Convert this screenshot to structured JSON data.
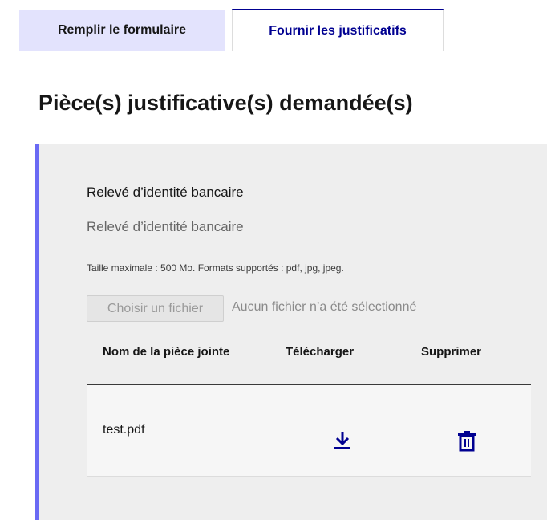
{
  "tabs": [
    {
      "label": "Remplir le formulaire",
      "active": false
    },
    {
      "label": "Fournir les justificatifs",
      "active": true
    }
  ],
  "page_title": "Pièce(s) justificative(s) demandée(s)",
  "document": {
    "label": "Relevé d’identité bancaire",
    "hint": "Relevé d’identité bancaire",
    "size_hint": "Taille maximale : 500 Mo. Formats supportés : pdf, jpg, jpeg.",
    "file_button": "Choisir un fichier",
    "file_status": "Aucun fichier n’a été sélectionné"
  },
  "table": {
    "headers": [
      "Nom de la pièce jointe",
      "Télécharger",
      "Supprimer"
    ],
    "rows": [
      {
        "file_name": "test.pdf",
        "download_icon": "download-icon",
        "delete_icon": "trash-icon"
      }
    ]
  },
  "colors": {
    "accent": "#000091",
    "panel_border": "#6a6af4",
    "inactive_tab": "#e3e3fd",
    "panel_bg": "#eeeeee"
  }
}
